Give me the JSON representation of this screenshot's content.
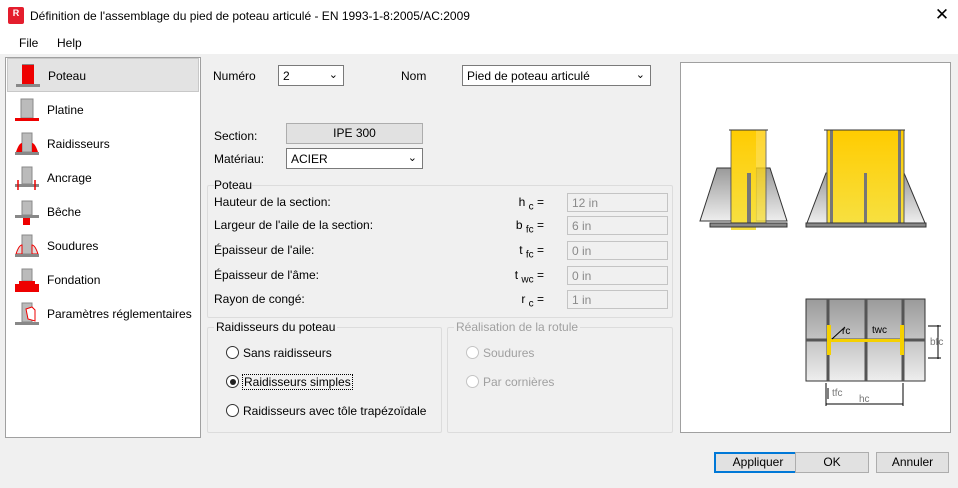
{
  "window": {
    "title": "Définition de l'assemblage du pied de poteau articulé - EN 1993-1-8:2005/AC:2009",
    "app_icon": "R",
    "close": "✕"
  },
  "menu": {
    "file": "File",
    "help": "Help"
  },
  "sidebar": {
    "items": [
      {
        "label": "Poteau"
      },
      {
        "label": "Platine"
      },
      {
        "label": "Raidisseurs"
      },
      {
        "label": "Ancrage"
      },
      {
        "label": "Bêche"
      },
      {
        "label": "Soudures"
      },
      {
        "label": "Fondation"
      },
      {
        "label": "Paramètres réglementaires"
      }
    ]
  },
  "form": {
    "numero_label": "Numéro",
    "numero_value": "2",
    "nom_label": "Nom",
    "nom_value": "Pied de poteau articulé",
    "section_label": "Section:",
    "section_value": "IPE 300",
    "materiau_label": "Matériau:",
    "materiau_value": "ACIER"
  },
  "poteau": {
    "title": "Poteau",
    "rows": [
      {
        "label": "Hauteur de la section:",
        "sym": "h",
        "sub": "c",
        "value": "12 in"
      },
      {
        "label": "Largeur de l'aile de la section:",
        "sym": "b",
        "sub": "fc",
        "value": "6 in"
      },
      {
        "label": "Épaisseur de l'aile:",
        "sym": "t",
        "sub": "fc",
        "value": "0 in"
      },
      {
        "label": "Épaisseur de l'âme:",
        "sym": "t",
        "sub": "wc",
        "value": "0 in"
      },
      {
        "label": "Rayon de congé:",
        "sym": "r",
        "sub": "c",
        "value": "1 in"
      }
    ]
  },
  "raidisseurs": {
    "title": "Raidisseurs du poteau",
    "options": [
      "Sans raidisseurs",
      "Raidisseurs simples",
      "Raidisseurs avec tôle trapézoïdale"
    ],
    "selected": 1
  },
  "rotule": {
    "title": "Réalisation de la rotule",
    "options": [
      "Soudures",
      "Par cornières"
    ]
  },
  "diagram": {
    "labels": {
      "rc": "rc",
      "twc": "twc",
      "bfc": "bfc",
      "tfc": "tfc",
      "hc": "hc"
    }
  },
  "buttons": {
    "apply": "Appliquer",
    "ok": "OK",
    "cancel": "Annuler"
  }
}
